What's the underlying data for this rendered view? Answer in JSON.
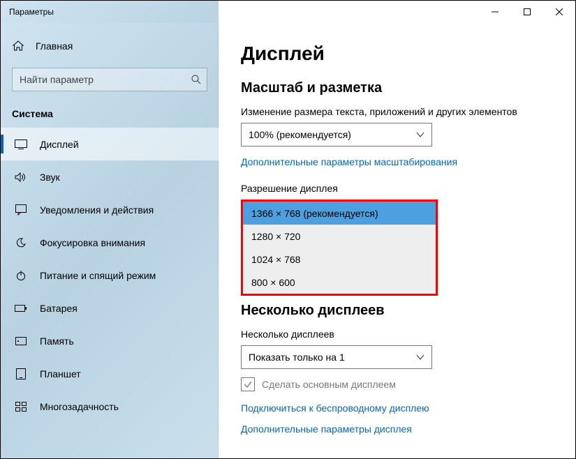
{
  "window": {
    "title": "Параметры"
  },
  "sidebar": {
    "home": "Главная",
    "search_placeholder": "Найти параметр",
    "section": "Система",
    "items": [
      {
        "label": "Дисплей"
      },
      {
        "label": "Звук"
      },
      {
        "label": "Уведомления и действия"
      },
      {
        "label": "Фокусировка внимания"
      },
      {
        "label": "Питание и спящий режим"
      },
      {
        "label": "Батарея"
      },
      {
        "label": "Память"
      },
      {
        "label": "Планшет"
      },
      {
        "label": "Многозадачность"
      }
    ]
  },
  "main": {
    "title": "Дисплей",
    "scale_heading": "Масштаб и разметка",
    "scale_label": "Изменение размера текста, приложений и других элементов",
    "scale_value": "100% (рекомендуется)",
    "advanced_scale_link": "Дополнительные параметры масштабирования",
    "resolution_label": "Разрешение дисплея",
    "resolution_options": [
      "1366 × 768 (рекомендуется)",
      "1280 × 720",
      "1024 × 768",
      "800 × 600"
    ],
    "multi_heading": "Несколько дисплеев",
    "multi_label": "Несколько дисплеев",
    "multi_value": "Показать только на 1",
    "make_primary": "Сделать основным дисплеем",
    "wireless_link": "Подключиться к беспроводному дисплею",
    "advanced_display_link": "Дополнительные параметры дисплея"
  }
}
